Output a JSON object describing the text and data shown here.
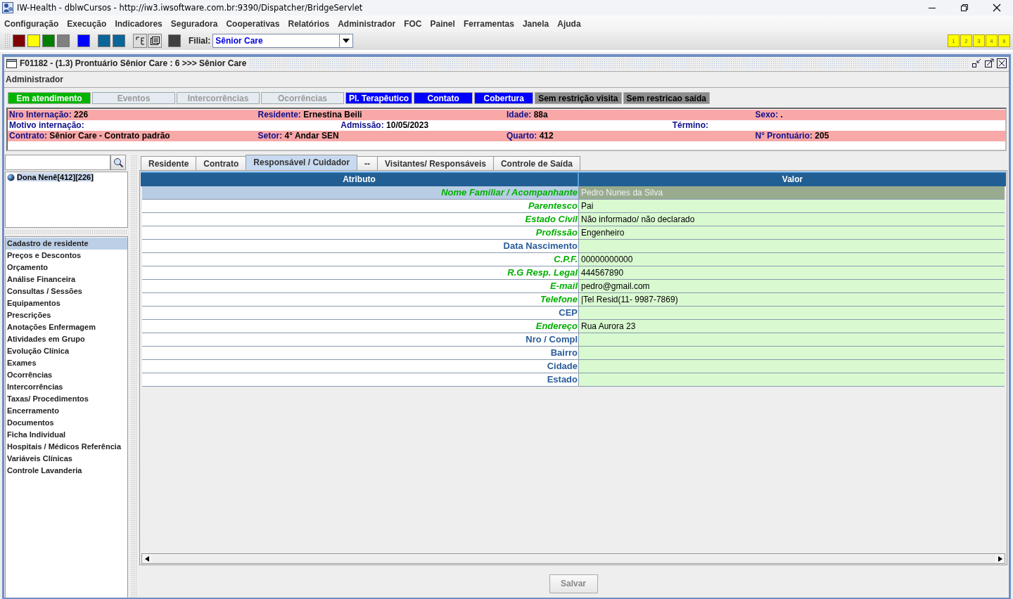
{
  "window": {
    "title": "IW-Health - dblwCursos - http://iw3.iwsoftware.com.br:9390/Dispatcher/BridgeServlet"
  },
  "menu": [
    "Configuração",
    "Execução",
    "Indicadores",
    "Seguradora",
    "Cooperativas",
    "Relatórios",
    "Administrador",
    "FOC",
    "Painel",
    "Ferramentas",
    "Janela",
    "Ajuda"
  ],
  "toolbar": {
    "items": [
      {
        "kind": "color",
        "color": "#800000"
      },
      {
        "kind": "color",
        "color": "#ffff00"
      },
      {
        "kind": "color",
        "color": "#008000"
      },
      {
        "kind": "color",
        "color": "#808080"
      },
      {
        "kind": "gap"
      },
      {
        "kind": "color",
        "color": "#0000ff"
      },
      {
        "kind": "gap"
      },
      {
        "kind": "color",
        "color": "#0a6598"
      },
      {
        "kind": "color",
        "color": "#0a6598"
      },
      {
        "kind": "gap"
      },
      {
        "kind": "tool"
      },
      {
        "kind": "tool"
      },
      {
        "kind": "gap"
      },
      {
        "kind": "color",
        "color": "#404040"
      }
    ],
    "filial_label": "Filial:",
    "filial_value": "Sênior Care",
    "window_buttons": [
      "1",
      "2",
      "3",
      "4",
      "6"
    ]
  },
  "frame": {
    "title": "F01182 - (1.3) Prontuário Sênior Care : 6 >>> Sênior Care",
    "user": "Administrador"
  },
  "status_buttons": [
    {
      "label": "Em atendimento",
      "color": "#00b400",
      "disabled": false
    },
    {
      "label": "Eventos",
      "color": "#e6ebf2",
      "disabled": true
    },
    {
      "label": "Intercorrências",
      "color": "#e6ebf2",
      "disabled": true
    },
    {
      "label": "Ocorrências",
      "color": "#e6ebf2",
      "disabled": true
    },
    {
      "label": "Pl. Terapêutico",
      "color": "#0000ff",
      "disabled": false
    },
    {
      "label": "Contato",
      "color": "#0000ff",
      "disabled": false
    },
    {
      "label": "Cobertura",
      "color": "#0000ff",
      "disabled": false
    },
    {
      "label": "Sem restrição visita",
      "color": "#8c8c8c",
      "disabled": false
    },
    {
      "label": "Sem restricao saída",
      "color": "#8c8c8c",
      "disabled": false
    }
  ],
  "info_rows": [
    {
      "fields": [
        {
          "label": "Nro Internação:",
          "value": "226"
        },
        {
          "label": "Residente:",
          "value": "Ernestina Beili"
        },
        {
          "label": "Idade:",
          "value": "88a"
        },
        {
          "label": "Sexo:",
          "value": "."
        }
      ]
    },
    {
      "fields": [
        {
          "label": "Motivo internação:"
        },
        {
          "label": "Admissão:",
          "value": "10/05/2023"
        },
        {
          "label": "Término:"
        }
      ]
    },
    {
      "fields": [
        {
          "label": "Contrato:",
          "value": "Sênior Care - Contrato padrão"
        },
        {
          "label": "Setor:",
          "value": "4° Andar SEN"
        },
        {
          "label": "Quarto:",
          "value": "412"
        },
        {
          "label": "N° Prontuário:",
          "value": "205"
        }
      ]
    }
  ],
  "residents": [
    {
      "label": "Dona Nenê[412][226]",
      "selected": true
    }
  ],
  "nav": [
    {
      "label": "Cadastro de residente",
      "selected": true
    },
    {
      "label": "Preços e Descontos",
      "selected": false
    },
    {
      "label": "Orçamento",
      "selected": false
    },
    {
      "label": "Análise Financeira",
      "selected": false
    },
    {
      "label": "Consultas / Sessões",
      "selected": false
    },
    {
      "label": "Equipamentos",
      "selected": false
    },
    {
      "label": "Prescrições",
      "selected": false
    },
    {
      "label": "Anotações Enfermagem",
      "selected": false
    },
    {
      "label": "Atividades em Grupo",
      "selected": false
    },
    {
      "label": "Evolução Clínica",
      "selected": false
    },
    {
      "label": "Exames",
      "selected": false
    },
    {
      "label": "Ocorrências",
      "selected": false
    },
    {
      "label": "Intercorrências",
      "selected": false
    },
    {
      "label": "Taxas/ Procedimentos",
      "selected": false
    },
    {
      "label": "Encerramento",
      "selected": false
    },
    {
      "label": "Documentos",
      "selected": false
    },
    {
      "label": "Ficha Individual",
      "selected": false
    },
    {
      "label": "Hospitais / Médicos Referência",
      "selected": false
    },
    {
      "label": "Variáveis Clínicas",
      "selected": false
    },
    {
      "label": "Controle Lavanderia",
      "selected": false
    }
  ],
  "tabs": [
    {
      "label": "Residente",
      "selected": false
    },
    {
      "label": "Contrato",
      "selected": false
    },
    {
      "label": "Responsável / Cuidador",
      "selected": true
    },
    {
      "label": "--",
      "selected": false
    },
    {
      "label": "Visitantes/ Responsáveis",
      "selected": false
    },
    {
      "label": "Controle de Saída",
      "selected": false
    }
  ],
  "table": {
    "columns": [
      "Atributo",
      "Valor"
    ],
    "rows": [
      {
        "attribute": "Nome Familiar / Acompanhante",
        "value": "Pedro Nunes da Silva",
        "kind": "filled",
        "selected": true
      },
      {
        "attribute": "Parentesco",
        "value": "Pai",
        "kind": "filled",
        "selected": false
      },
      {
        "attribute": "Estado Civil",
        "value": "Não informado/ não declarado",
        "kind": "filled",
        "selected": false
      },
      {
        "attribute": "Profissão",
        "value": "Engenheiro",
        "kind": "filled",
        "selected": false
      },
      {
        "attribute": "Data Nascimento",
        "kind": "blank",
        "selected": false
      },
      {
        "attribute": "C.P.F.",
        "value": "00000000000",
        "kind": "filled",
        "selected": false
      },
      {
        "attribute": "R.G Resp. Legal",
        "value": "444567890",
        "kind": "filled",
        "selected": false
      },
      {
        "attribute": "E-mail",
        "value": "pedro@gmail.com",
        "kind": "filled",
        "selected": false
      },
      {
        "attribute": "Telefone",
        "value": "|Tel Resid(11- 9987-7869)",
        "kind": "filled",
        "selected": false
      },
      {
        "attribute": "CEP",
        "kind": "blank",
        "selected": false
      },
      {
        "attribute": "Endereço",
        "value": "Rua Aurora 23",
        "kind": "filled",
        "selected": false
      },
      {
        "attribute": "Nro / Compl",
        "kind": "blank",
        "selected": false
      },
      {
        "attribute": "Bairro",
        "kind": "blank",
        "selected": false
      },
      {
        "attribute": "Cidade",
        "kind": "blank",
        "selected": false
      },
      {
        "attribute": "Estado",
        "kind": "blank",
        "selected": false
      }
    ]
  },
  "save_button": {
    "label": "Salvar",
    "disabled": true
  }
}
